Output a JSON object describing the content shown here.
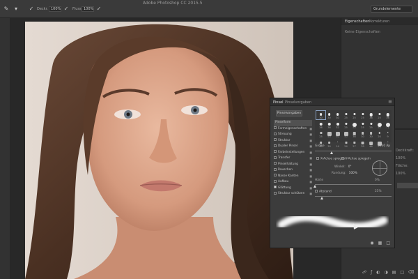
{
  "app": {
    "window_title": "Adobe Photoshop CC 2015.5",
    "workspace": "Grundelemente"
  },
  "options_bar": {
    "opacity_label": "Deckr.",
    "opacity_value": "100%",
    "flow_label": "Fluss:",
    "flow_value": "100%"
  },
  "properties_panel": {
    "tabs": [
      {
        "label": "Eigenschaften",
        "active": true
      },
      {
        "label": "Korrekturen",
        "active": false
      }
    ],
    "message": "Keine Eigenschaften",
    "layer_rows": [
      {
        "label": "Deckkraft:",
        "value": "100%"
      },
      {
        "label": "Fläche:",
        "value": "100%"
      }
    ]
  },
  "brush_panel": {
    "tabs": [
      {
        "label": "Pinsel",
        "active": true
      },
      {
        "label": "Pinselvorgaben",
        "active": false
      }
    ],
    "presets_button": "Pinselvorgaben",
    "options": [
      {
        "label": "Pinselform",
        "checked": false,
        "first": true
      },
      {
        "label": "Formeigenschaften",
        "checked": false
      },
      {
        "label": "Streuung",
        "checked": false
      },
      {
        "label": "Struktur",
        "checked": false
      },
      {
        "label": "Dualer Pinsel",
        "checked": false
      },
      {
        "label": "Farbeinstellungen",
        "checked": false
      },
      {
        "label": "Transfer",
        "checked": false
      },
      {
        "label": "Pinselhaltung",
        "checked": false
      },
      {
        "label": "Rauschen",
        "checked": false
      },
      {
        "label": "Nasse Kanten",
        "checked": false
      },
      {
        "label": "Aufbau",
        "checked": false
      },
      {
        "label": "Glättung",
        "checked": true
      },
      {
        "label": "Struktur schützen",
        "checked": false
      }
    ],
    "tip_sizes": [
      "30",
      "30",
      "30",
      "25",
      "25",
      "25",
      "36",
      "25",
      "36",
      "36",
      "36",
      "32",
      "25",
      "50",
      "25",
      "25",
      "50",
      "71",
      "25",
      "50",
      "50",
      "50",
      "36",
      "30",
      "30",
      "20",
      "9",
      "30",
      "30",
      "14",
      "24",
      "27",
      "39",
      "46",
      "59",
      "11"
    ],
    "size_label": "Größe",
    "size_value": "30 Px",
    "flip_x": "X-Achse spiegeln",
    "flip_y": "Y-Achse spiegeln",
    "angle_label": "Winkel:",
    "angle_value": "0°",
    "roundness_label": "Rundung:",
    "roundness_value": "100%",
    "hardness_label": "Härte",
    "hardness_value": "0%",
    "spacing_label": "Abstand",
    "spacing_value": "25%"
  },
  "colors": {
    "panel_bg": "#3c3c3c",
    "dock_bg": "#323232",
    "topbar_bg": "#3a3a3a"
  }
}
